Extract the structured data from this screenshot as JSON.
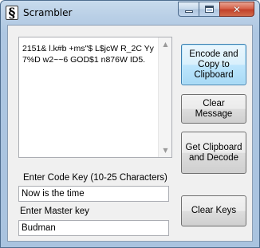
{
  "window": {
    "title": "Scrambler",
    "icon": "dollar-s-glyph",
    "icon_glyph": "§",
    "caption": {
      "minimize_icon": "minimize-icon",
      "maximize_icon": "maximize-icon",
      "close_icon": "close-icon",
      "close_glyph": "✕"
    }
  },
  "message": {
    "text": "2151& l.k#b +ms\"$ L$jcW R_2C Yy7%D w2~~6 GOD$1 n876W ID5.",
    "scroll_up_glyph": "▲",
    "scroll_down_glyph": "▼"
  },
  "buttons": {
    "encode": "Encode and\nCopy to\nClipboard",
    "clear_message": "Clear\nMessage",
    "decode": "Get Clipboard\nand Decode",
    "clear_keys": "Clear Keys"
  },
  "code_key": {
    "label": "Enter Code Key (10-25 Characters)",
    "value": "Now is the time"
  },
  "master_key": {
    "label": "Enter Master key",
    "value": "Budman"
  },
  "colors": {
    "title_bar": "#b9cfe6",
    "close_button": "#c2412a",
    "default_button": "#a7d9f5",
    "client_background": "#f0f0f0"
  }
}
